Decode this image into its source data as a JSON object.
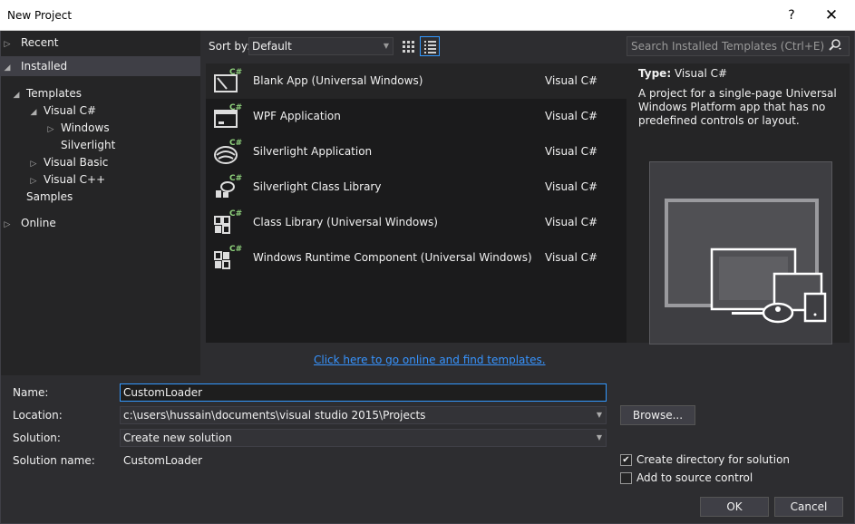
{
  "window": {
    "title": "New Project",
    "help_glyph": "?",
    "close_glyph": "✕"
  },
  "tree": {
    "recent": "Recent",
    "installed": "Installed",
    "templates": "Templates",
    "visual_csharp": "Visual C#",
    "windows": "Windows",
    "silverlight": "Silverlight",
    "visual_basic": "Visual Basic",
    "visual_cpp": "Visual C++",
    "samples": "Samples",
    "online": "Online"
  },
  "toolbar": {
    "sort_label": "Sort by:",
    "sort_value": "Default",
    "search_placeholder": "Search Installed Templates (Ctrl+E)"
  },
  "templates": [
    {
      "name": "Blank App (Universal Windows)",
      "lang": "Visual C#",
      "icon": "blank-app-icon"
    },
    {
      "name": "WPF Application",
      "lang": "Visual C#",
      "icon": "wpf-app-icon"
    },
    {
      "name": "Silverlight Application",
      "lang": "Visual C#",
      "icon": "silverlight-app-icon"
    },
    {
      "name": "Silverlight Class Library",
      "lang": "Visual C#",
      "icon": "silverlight-class-library-icon"
    },
    {
      "name": "Class Library (Universal Windows)",
      "lang": "Visual C#",
      "icon": "class-library-icon"
    },
    {
      "name": "Windows Runtime Component (Universal Windows)",
      "lang": "Visual C#",
      "icon": "runtime-component-icon"
    }
  ],
  "details": {
    "type_label": "Type:",
    "type_value": "Visual C#",
    "description": "A project for a single-page Universal Windows Platform app that has no predefined controls or layout."
  },
  "online_link": "Click here to go online and find templates.",
  "form": {
    "name_label": "Name:",
    "name_value": "CustomLoader",
    "location_label": "Location:",
    "location_value": "c:\\users\\hussain\\documents\\visual studio 2015\\Projects",
    "solution_label": "Solution:",
    "solution_value": "Create new solution",
    "solution_name_label": "Solution name:",
    "solution_name_value": "CustomLoader",
    "browse": "Browse...",
    "create_dir": "Create directory for solution",
    "create_dir_checked": true,
    "add_source": "Add to source control",
    "add_source_checked": false,
    "ok": "OK",
    "cancel": "Cancel"
  },
  "colors": {
    "accent": "#3399ff",
    "link": "#3794ff",
    "background": "#2d2d30"
  }
}
